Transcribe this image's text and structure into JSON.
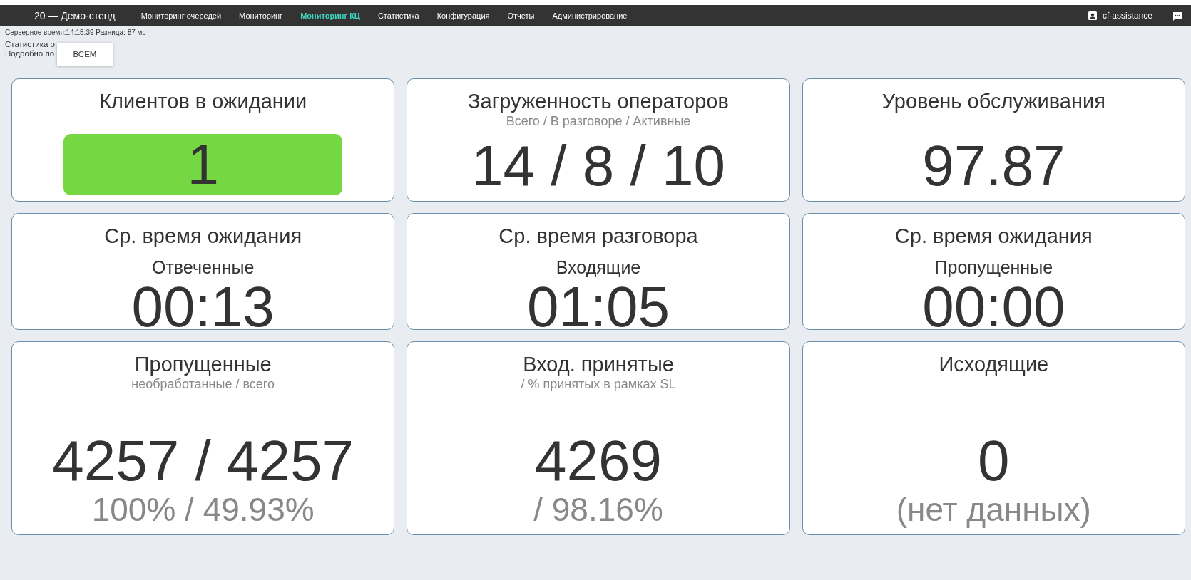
{
  "nav": {
    "brand": "20 — Демо-стенд",
    "items": [
      {
        "label": "Мониторинг очередей",
        "selected": false
      },
      {
        "label": "Мониторинг",
        "selected": false
      },
      {
        "label": "Мониторинг КЦ",
        "selected": true
      },
      {
        "label": "Статистика",
        "selected": false
      },
      {
        "label": "Конфигурация",
        "selected": false
      },
      {
        "label": "Отчеты",
        "selected": false
      },
      {
        "label": "Администрирование",
        "selected": false
      }
    ],
    "user": "cf-assistance"
  },
  "info": {
    "server_time": "Серверное время:14:15:39  Разница: 87 мс",
    "lines": [
      "Статистика о",
      "Подробно по"
    ]
  },
  "popup": {
    "items": [
      "ВСЕМ"
    ]
  },
  "cards": [
    {
      "title": "Клиентов в ожидании",
      "lines": [
        {
          "kind": "highlight",
          "text": "1"
        }
      ]
    },
    {
      "title": "Загруженность операторов",
      "lines": [
        {
          "kind": "note",
          "text": "Всего / В разговоре / Активные"
        },
        {
          "kind": "value",
          "text": "14 / 8 / 10"
        }
      ]
    },
    {
      "title": "Уровень обслуживания",
      "lines": [
        {
          "kind": "value",
          "text": "97.87"
        }
      ]
    },
    {
      "title": "Ср. время ожидания",
      "lines": [
        {
          "kind": "label",
          "text": "Отвеченные"
        },
        {
          "kind": "value",
          "text": "00:13"
        }
      ]
    },
    {
      "title": "Ср. время разговора",
      "lines": [
        {
          "kind": "label",
          "text": "Входящие"
        },
        {
          "kind": "value",
          "text": "01:05"
        }
      ]
    },
    {
      "title": "Ср. время ожидания",
      "lines": [
        {
          "kind": "label",
          "text": "Пропущенные"
        },
        {
          "kind": "value",
          "text": "00:00"
        }
      ]
    },
    {
      "title": "Пропущенные",
      "lines": [
        {
          "kind": "note",
          "text": "необработанные / всего"
        },
        {
          "kind": "value",
          "text": "4257 / 4257"
        },
        {
          "kind": "secondary",
          "text": "100% / 49.93%"
        }
      ]
    },
    {
      "title": "Вход. принятые",
      "lines": [
        {
          "kind": "note",
          "text": "/ % принятых в рамках SL"
        },
        {
          "kind": "value",
          "text": "4269"
        },
        {
          "kind": "secondary",
          "text": "/ 98.16%"
        }
      ]
    },
    {
      "title": "Исходящие",
      "lines": [
        {
          "kind": "spacer"
        },
        {
          "kind": "value",
          "text": "0"
        },
        {
          "kind": "secondary",
          "text": "(нет данных)"
        }
      ]
    }
  ]
}
